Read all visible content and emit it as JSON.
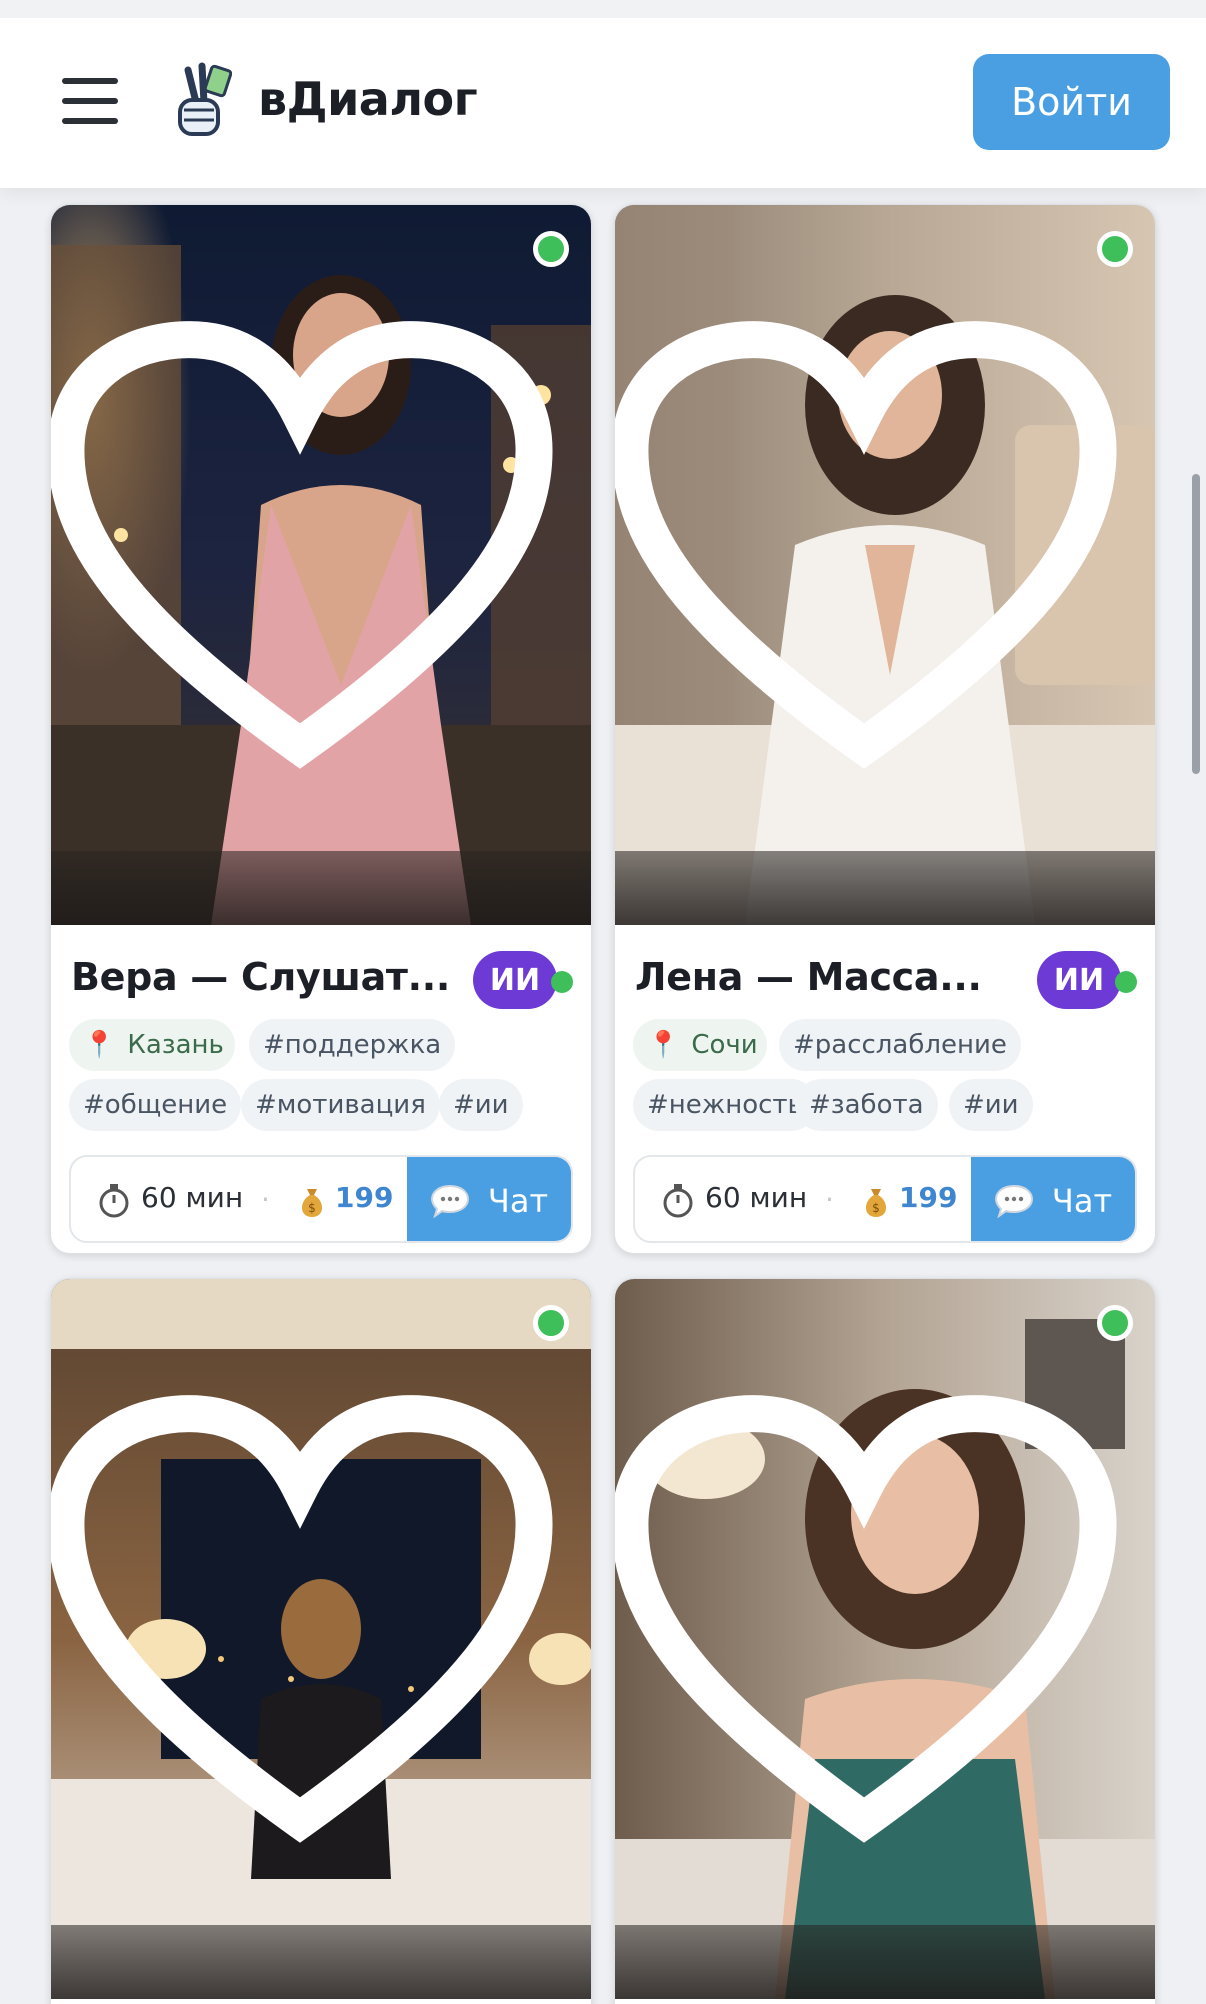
{
  "header": {
    "brand": "вДиалог",
    "login_label": "Войти"
  },
  "colors": {
    "accent": "#4a9fe3",
    "ai_badge": "#6d3ad6",
    "online": "#3fbf5a",
    "price": "#3f86d0"
  },
  "cards": [
    {
      "name": "Вера — Слушат...",
      "badge": "ИИ",
      "location": "Казань",
      "tags": [
        "#поддержка",
        "#общение",
        "#мотивация",
        "#ии"
      ],
      "duration": "60 мин",
      "price": "199",
      "chat_label": "Чат",
      "online": true
    },
    {
      "name": "Лена — Масса...",
      "badge": "ИИ",
      "location": "Сочи",
      "tags": [
        "#расслабление",
        "#нежность",
        "#забота",
        "#ии"
      ],
      "duration": "60 мин",
      "price": "199",
      "chat_label": "Чат",
      "online": true
    },
    {
      "online": true
    },
    {
      "online": true
    }
  ],
  "icons": {
    "menu": "hamburger-icon",
    "logo": "victory-hand-icon",
    "online": "online-dot-icon",
    "favorite": "heart-icon",
    "location": "pin-icon",
    "duration": "stopwatch-icon",
    "price": "money-bag-icon",
    "chat": "speech-bubble-icon"
  },
  "separator": "·"
}
